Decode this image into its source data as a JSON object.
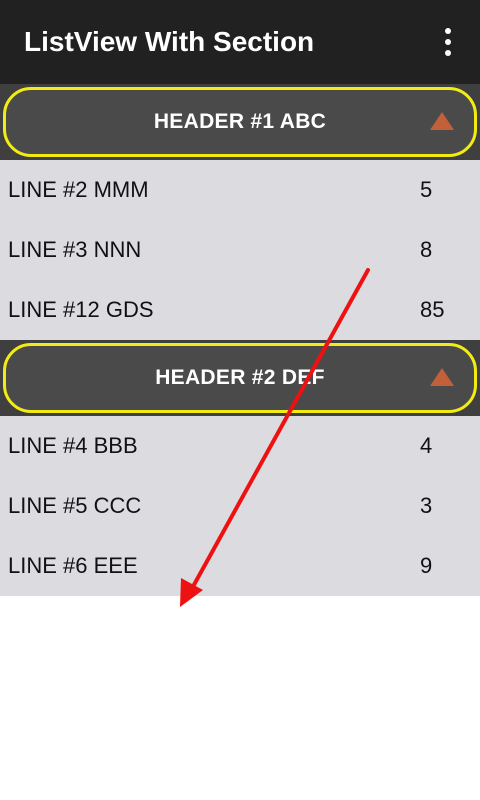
{
  "app_bar": {
    "title": "ListView With Section",
    "menu_icon": "more-vert-icon"
  },
  "sections": [
    {
      "header": "HEADER #1 ABC",
      "expand_icon": "collapse-triangle-icon",
      "rows": [
        {
          "label": "LINE #2 MMM",
          "value": "5"
        },
        {
          "label": "LINE #3 NNN",
          "value": "8"
        },
        {
          "label": "LINE #12 GDS",
          "value": "85"
        }
      ]
    },
    {
      "header": "HEADER #2 DEF",
      "expand_icon": "collapse-triangle-icon",
      "rows": [
        {
          "label": "LINE #4 BBB",
          "value": "4"
        },
        {
          "label": "LINE #5 CCC",
          "value": "3"
        },
        {
          "label": "LINE #6 EEE",
          "value": "9"
        }
      ]
    }
  ],
  "colors": {
    "app_bar": "#212121",
    "header_border": "#f2ec14",
    "header_bg": "#4a4a4a",
    "row_bg": "#dcdbe0",
    "triangle": "#c2603a",
    "annotation_arrow": "#ee1111"
  }
}
